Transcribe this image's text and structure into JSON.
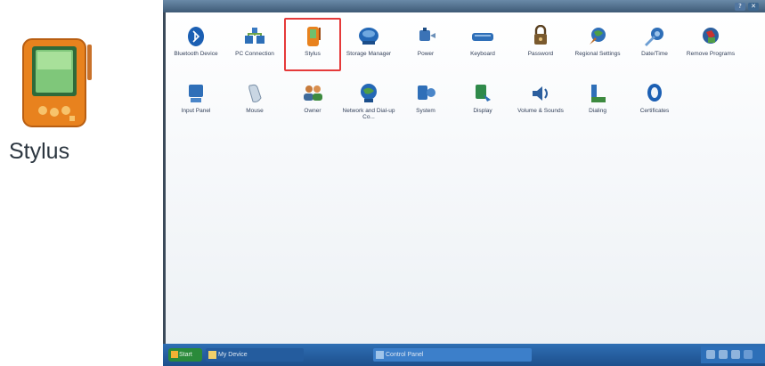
{
  "callout": {
    "label": "Stylus",
    "icon": "stylus-pda-icon"
  },
  "window": {
    "help_label": "?",
    "close_icon": "close-icon"
  },
  "items": [
    {
      "label": "Bluetooth Device",
      "icon": "bluetooth-icon"
    },
    {
      "label": "PC Connection",
      "icon": "pc-connection-icon"
    },
    {
      "label": "Stylus",
      "icon": "stylus-icon",
      "selected": true
    },
    {
      "label": "Storage Manager",
      "icon": "storage-icon"
    },
    {
      "label": "Power",
      "icon": "power-icon"
    },
    {
      "label": "Keyboard",
      "icon": "keyboard-icon"
    },
    {
      "label": "Password",
      "icon": "password-icon"
    },
    {
      "label": "Regional Settings",
      "icon": "regional-settings-icon"
    },
    {
      "label": "Date/Time",
      "icon": "date-time-icon"
    },
    {
      "label": "Remove Programs",
      "icon": "remove-programs-icon"
    },
    {
      "label": "Input Panel",
      "icon": "input-panel-icon"
    },
    {
      "label": "Mouse",
      "icon": "mouse-icon"
    },
    {
      "label": "Owner",
      "icon": "owner-icon"
    },
    {
      "label": "Network and Dial-up Co...",
      "icon": "network-icon"
    },
    {
      "label": "System",
      "icon": "system-icon"
    },
    {
      "label": "Display",
      "icon": "display-icon"
    },
    {
      "label": "Volume & Sounds",
      "icon": "volume-icon"
    },
    {
      "label": "Dialing",
      "icon": "dialing-icon"
    },
    {
      "label": "Certificates",
      "icon": "certificates-icon"
    }
  ],
  "taskbar": {
    "start_label": "Start",
    "task1": "My Device",
    "task2": "Control Panel"
  },
  "colors": {
    "selection": "#e53a3a",
    "taskbar": "#2f6fb4"
  }
}
